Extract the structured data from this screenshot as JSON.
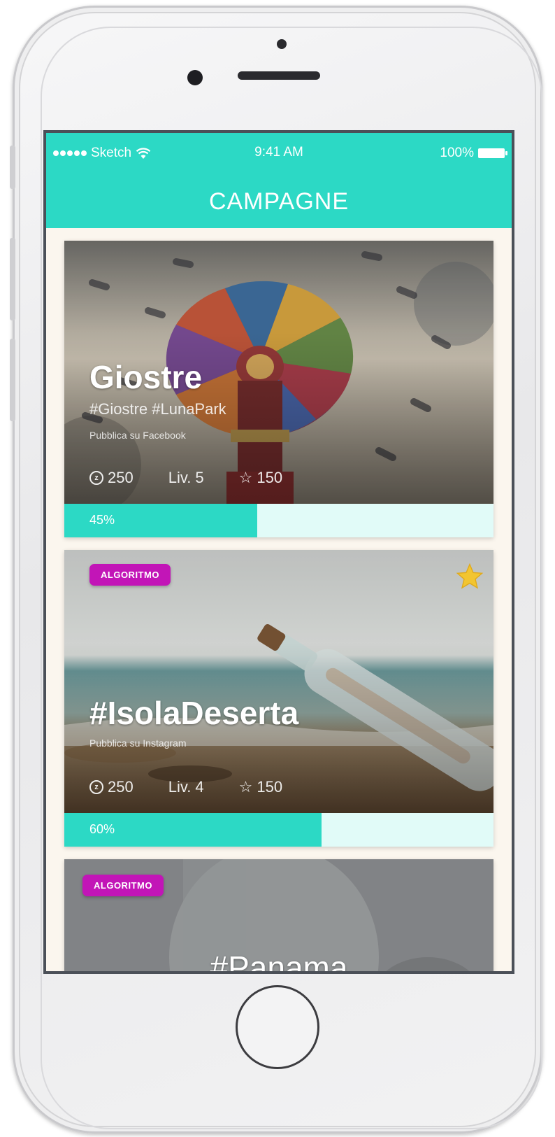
{
  "statusbar": {
    "carrier": "Sketch",
    "time": "9:41 AM",
    "battery": "100%"
  },
  "nav": {
    "title": "CAMPAGNE"
  },
  "cards": [
    {
      "title": "Giostre",
      "tags": "#Giostre  #LunaPark",
      "subtitle": "Pubblica su Facebook",
      "coins": "250",
      "level": "Liv. 5",
      "stars": "150",
      "progress_label": "45%",
      "progress": 0.45
    },
    {
      "badge": "ALGORITMO",
      "favorite": true,
      "title": "#IsolaDeserta",
      "subtitle": "Pubblica su Instagram",
      "coins": "250",
      "level": "Liv. 4",
      "stars": "150",
      "progress_label": "60%",
      "progress": 0.6
    },
    {
      "badge": "ALGORITMO",
      "title": "#Panama"
    }
  ],
  "colors": {
    "accent": "#2cd9c5",
    "badge": "#c215b7",
    "progress_track": "#e1fbf8"
  }
}
